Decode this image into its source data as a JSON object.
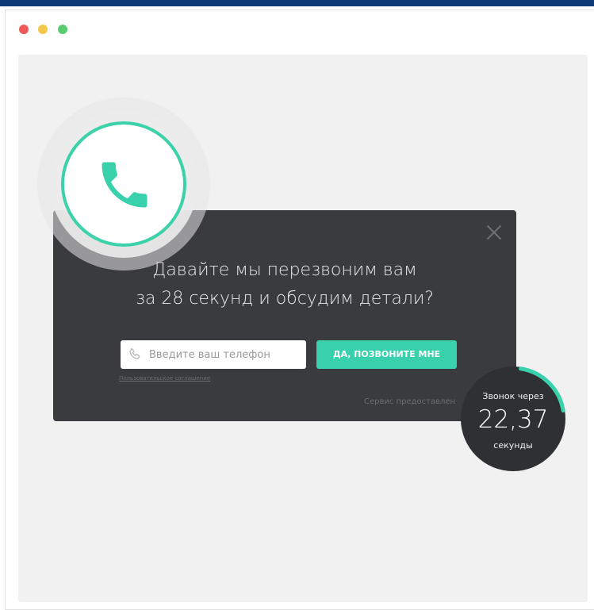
{
  "window": {
    "controls": [
      "close",
      "minimize",
      "maximize"
    ]
  },
  "widget": {
    "icon": "phone-icon",
    "accent_color": "#38d1ab"
  },
  "modal": {
    "headline_line1": "Давайте мы перезвоним вам",
    "headline_line2": "за 28 секунд и обсудим детали?",
    "phone_placeholder": "Введите ваш телефон",
    "phone_value": "",
    "call_button_label": "ДА, ПОЗВОНИТЕ МНЕ",
    "agreement_link": "Пользовательское соглашение",
    "service_text": "Сервис предоставлен"
  },
  "timer": {
    "label_top": "Звонок через",
    "value": "22,37",
    "label_bottom": "секунды",
    "progress": 0.2
  }
}
